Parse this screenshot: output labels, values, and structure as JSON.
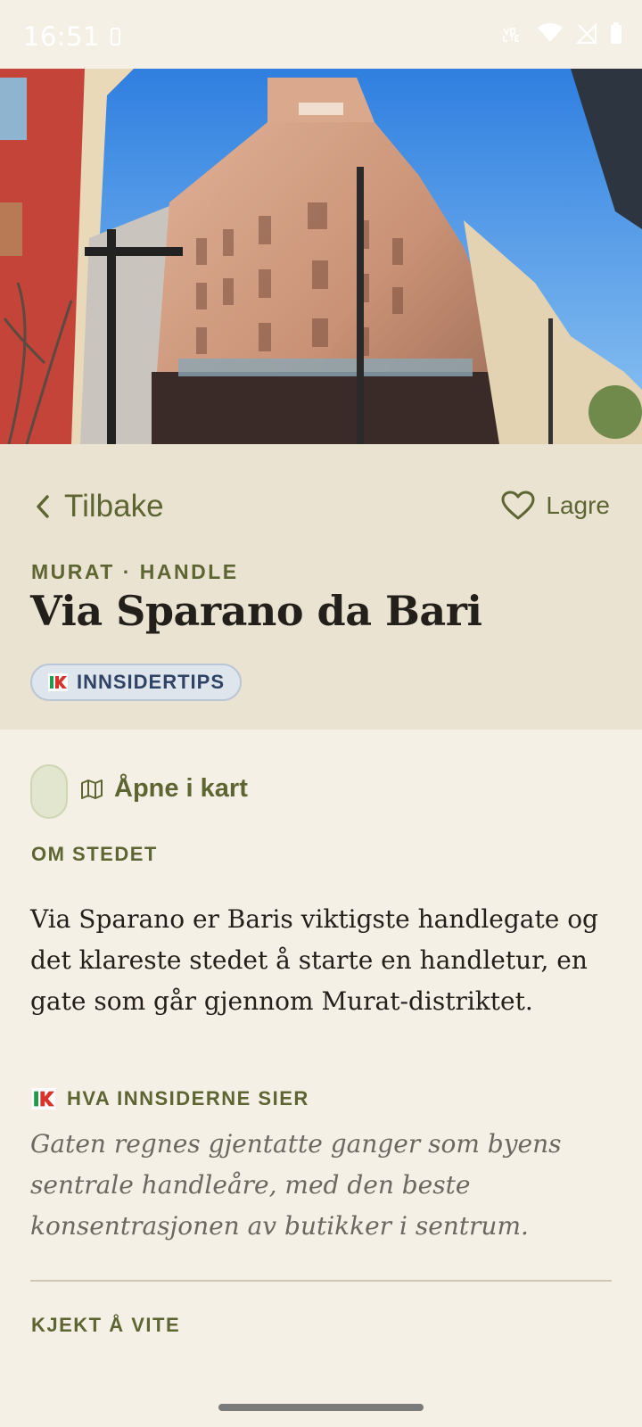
{
  "status_bar": {
    "time": "16:51"
  },
  "header": {
    "back_label": "Tilbake",
    "save_label": "Lagre",
    "eyebrow": "MURAT · HANDLE",
    "title": "Via Sparano da Bari",
    "badge_label": "INNSIDERTIPS"
  },
  "actions": {
    "map_label": "Åpne i kart"
  },
  "about": {
    "label": "OM STEDET",
    "text": "Via Sparano er Baris viktigste handlegate og det klareste stedet å starte en handletur, en gate som går gjennom Murat-distriktet."
  },
  "insiders": {
    "label": "HVA INNSIDERNE SIER",
    "quote": "Gaten regnes gjentatte ganger som byens sentrale handleåre, med den beste konsentrasjonen av butikker i sentrum."
  },
  "good_to_know": {
    "label": "KJEKT Å VITE"
  },
  "colors": {
    "accent": "#5d6532",
    "badge_text": "#2f4366",
    "background": "#f5f0e6",
    "header_bg": "#ebe3d2"
  },
  "icons": [
    "chevron-left-icon",
    "heart-icon",
    "map-icon",
    "ik-logo-icon"
  ]
}
